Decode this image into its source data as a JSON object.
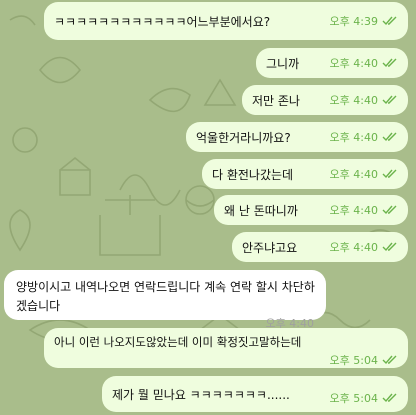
{
  "chat": {
    "messages": [
      {
        "text": "ㅋㅋㅋㅋㅋㅋㅋㅋㅋㅋㅋㅋ어느부분에서요?",
        "time": "오후 4:39",
        "direction": "outgoing",
        "status": "read"
      },
      {
        "text": "그니까",
        "time": "오후 4:40",
        "direction": "outgoing",
        "status": "read"
      },
      {
        "text": "저만 존나",
        "time": "오후 4:40",
        "direction": "outgoing",
        "status": "read"
      },
      {
        "text": "억울한거라니까요?",
        "time": "오후 4:40",
        "direction": "outgoing",
        "status": "read"
      },
      {
        "text": "다 환전나갔는데",
        "time": "오후 4:40",
        "direction": "outgoing",
        "status": "read"
      },
      {
        "text": "왜 난 돈따니까",
        "time": "오후 4:40",
        "direction": "outgoing",
        "status": "read"
      },
      {
        "text": "안주냐고요",
        "time": "오후 4:40",
        "direction": "outgoing",
        "status": "read"
      },
      {
        "text": "양방이시고 내역나오면 연락드립니다 계속 연락 할시 차단하겠습니다",
        "time": "오후 4:40",
        "direction": "incoming"
      },
      {
        "text": "아니 이런 나오지도않았는데 이미 확정짓고말하는데",
        "time": "오후 5:04",
        "direction": "outgoing",
        "status": "read"
      },
      {
        "text": "제가 뭘 믿나요 ㅋㅋㅋㅋㅋㅋㅋ......",
        "time": "오후 5:04",
        "direction": "outgoing",
        "status": "read"
      }
    ]
  },
  "theme": {
    "background": "#a9bd8b",
    "outgoing_bubble": "#effdde",
    "incoming_bubble": "#ffffff",
    "read_check": "#6bb34b"
  }
}
